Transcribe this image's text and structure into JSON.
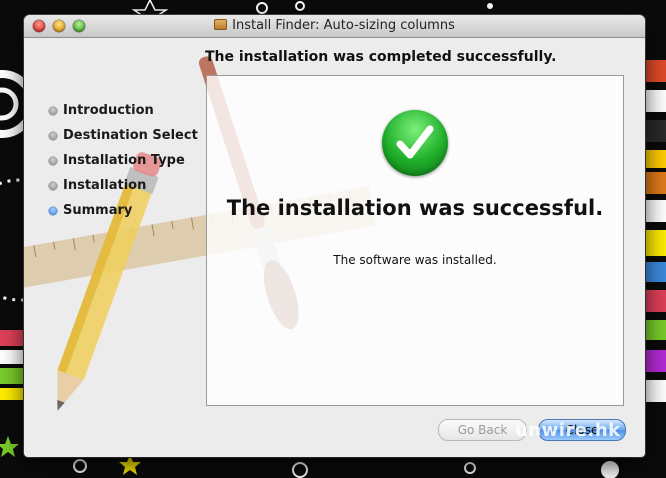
{
  "window": {
    "title": "Install Finder: Auto-sizing columns",
    "header": "The installation was completed successfully."
  },
  "steps": [
    {
      "label": "Introduction",
      "active": false
    },
    {
      "label": "Destination Select",
      "active": false
    },
    {
      "label": "Installation Type",
      "active": false
    },
    {
      "label": "Installation",
      "active": false
    },
    {
      "label": "Summary",
      "active": true
    }
  ],
  "content": {
    "success_title": "The installation was successful.",
    "message": "The software was installed.",
    "status_icon": "checkmark-icon"
  },
  "buttons": {
    "back_label": "Go Back",
    "close_label": "Close"
  },
  "watermark": "unwire.hk",
  "colors": {
    "success_green": "#1fae2a",
    "active_step_blue": "#3b7fd8",
    "default_button_blue": "#6aa6f0"
  }
}
